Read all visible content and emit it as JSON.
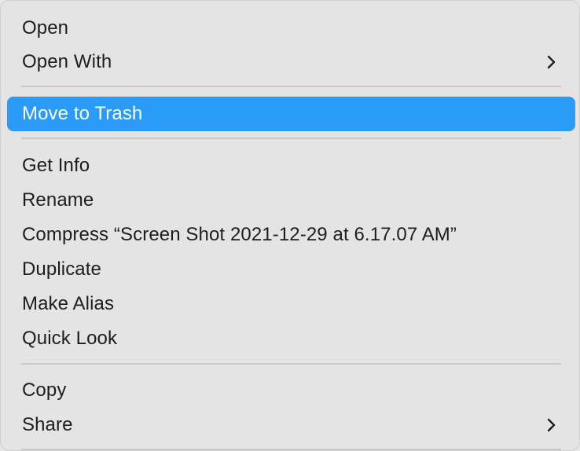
{
  "menu": {
    "items": [
      {
        "label": "Open"
      },
      {
        "label": "Open With",
        "submenu_icon": "chevron-right-icon"
      },
      {
        "label": "Move to Trash",
        "highlighted": true
      },
      {
        "label": "Get Info"
      },
      {
        "label": "Rename"
      },
      {
        "label": "Compress “Screen Shot 2021-12-29 at 6.17.07 AM”"
      },
      {
        "label": "Duplicate"
      },
      {
        "label": "Make Alias"
      },
      {
        "label": "Quick Look"
      },
      {
        "label": "Copy"
      },
      {
        "label": "Share",
        "submenu_icon": "chevron-right-icon"
      }
    ]
  },
  "colors": {
    "menu_background": "#e4e4e4",
    "highlight": "#2a9bf6",
    "separator": "#c8c8c8",
    "text": "#1d1d1d"
  }
}
